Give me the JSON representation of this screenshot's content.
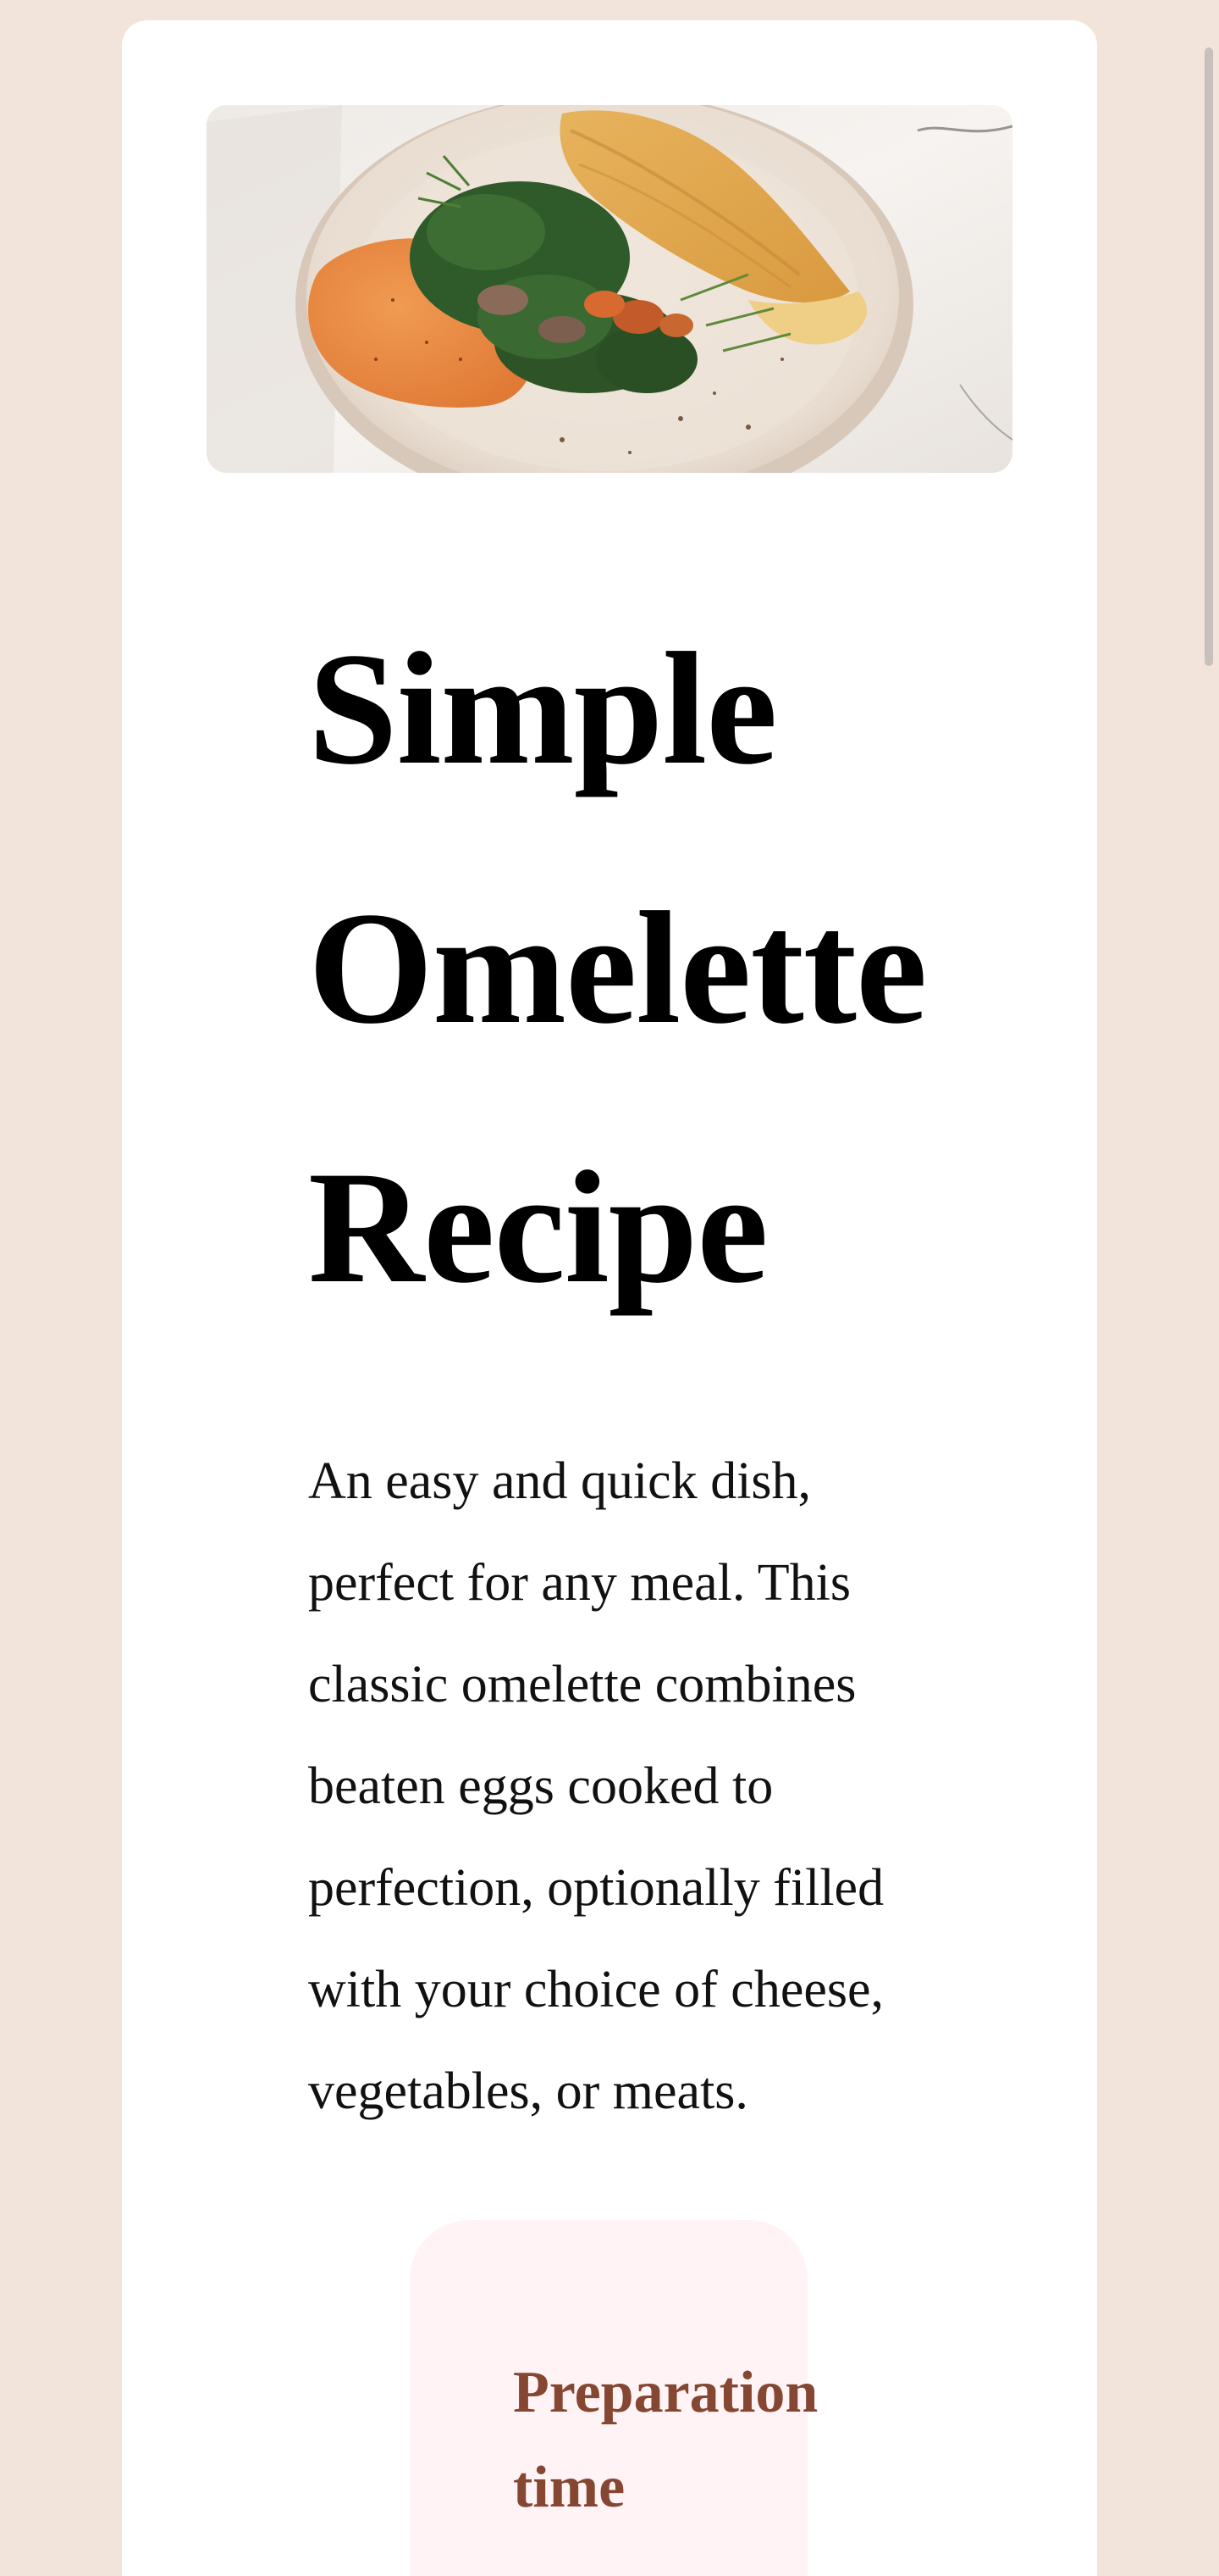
{
  "recipe": {
    "image_alt": "Omelette with spinach, mushrooms and herbs on a plate",
    "title": "Simple Omelette Recipe",
    "description": "An easy and quick dish, perfect for any meal. This classic omelette combines beaten eggs cooked to perfection, optionally filled with your choice of cheese, vegetables, or meats.",
    "preparation": {
      "heading": "Preparation time"
    }
  },
  "colors": {
    "page_background": "#f2e4da",
    "card_background": "#ffffff",
    "prep_background": "#fff3f6",
    "prep_heading": "#854632"
  }
}
